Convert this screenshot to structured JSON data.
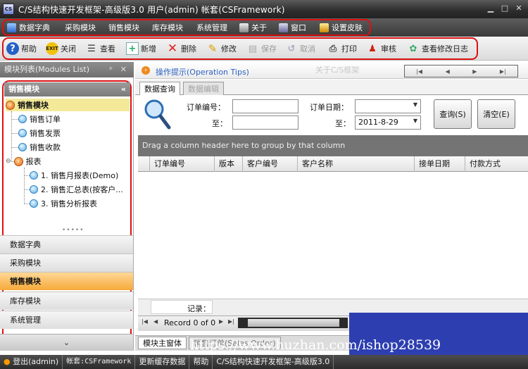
{
  "window": {
    "title": "C/S结构快速开发框架-高级版3.0 用户(admin) 帐套(CSFramework)",
    "icon_text": "CS"
  },
  "menu": [
    {
      "label": "数据字典",
      "icon": "dictionary-icon"
    },
    {
      "label": "采购模块",
      "icon": ""
    },
    {
      "label": "销售模块",
      "icon": ""
    },
    {
      "label": "库存模块",
      "icon": ""
    },
    {
      "label": "系统管理",
      "icon": ""
    },
    {
      "label": "关于",
      "icon": "about-icon"
    },
    {
      "label": "窗口",
      "icon": "window-icon"
    },
    {
      "label": "设置皮肤",
      "icon": "skin-icon"
    }
  ],
  "toolbar": {
    "help": "帮助",
    "close": "关闭",
    "view": "查看",
    "add": "新增",
    "delete": "删除",
    "edit": "修改",
    "save": "保存",
    "cancel": "取消",
    "print": "打印",
    "approve": "审核",
    "log": "查看修改日志"
  },
  "left_panel": {
    "title": "模块列表(Modules List)",
    "section": "销售模块",
    "tree": {
      "root": "销售模块",
      "items": [
        "销售订单",
        "销售发票",
        "销售收款"
      ],
      "reports": "报表",
      "report_items": [
        "1. 销售月报表(Demo)",
        "2. 销售汇总表(按客户...",
        "3. 销售分析报表"
      ]
    },
    "groups": [
      "数据字典",
      "采购模块",
      "销售模块",
      "库存模块",
      "系统管理"
    ],
    "active_group": "销售模块"
  },
  "tips": {
    "text": "操作提示(Operation Tips)",
    "about": "关于C/S框架"
  },
  "tabs": [
    "数据查询",
    "数据编辑"
  ],
  "query": {
    "order_no_label": "订单编号：",
    "to_label": "至：",
    "order_date_label": "订单日期：",
    "to_label2": "至：",
    "order_no_from": "",
    "order_no_to": "",
    "date_from": "",
    "date_to": "2011-8-29",
    "search_btn": "查询(S)",
    "clear_btn": "清空(E)"
  },
  "grid": {
    "group_hint": "Drag a column header here to group by that column",
    "columns": [
      "订单编号",
      "版本",
      "客户编号",
      "客户名称",
      "接单日期",
      "付款方式"
    ],
    "footer_label": "记录：",
    "pager_text": "Record 0 of 0"
  },
  "bottom_tabs": [
    "模块主窗体",
    "销售订单(Sales Order)"
  ],
  "watermark": "https://www.huzhan.com/ishop28539",
  "status": [
    "登出(admin)",
    "帐套:CSFramework",
    "更新缓存数据",
    "帮助",
    "C/S结构快速开发框架-高级版3.0"
  ]
}
